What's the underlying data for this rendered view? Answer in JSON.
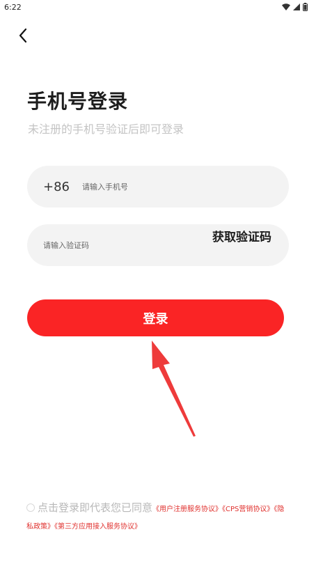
{
  "status_bar": {
    "time": "6:22"
  },
  "title": "手机号登录",
  "subtitle": "未注册的手机号验证后即可登录",
  "phone": {
    "country_code": "+86",
    "placeholder": "请输入手机号"
  },
  "code": {
    "placeholder": "请输入验证码",
    "get_code_label": "获取验证码"
  },
  "login_label": "登录",
  "agreement": {
    "text": "点击登录即代表您已同意",
    "links": [
      "《用户注册服务协议》",
      "《CPS营销协议》",
      "《隐私政策》",
      "《第三方应用接入服务协议》"
    ]
  },
  "icons": {
    "back": "back-arrow-icon",
    "wifi": "wifi-icon",
    "signal": "signal-icon",
    "battery": "battery-icon",
    "pointer_arrow": "red-pointer-arrow"
  },
  "colors": {
    "accent": "#fa2425",
    "title": "#1d1d1d",
    "subtitle": "#c4c4c4",
    "field_bg": "#f3f3f3",
    "link": "#e0322f"
  }
}
